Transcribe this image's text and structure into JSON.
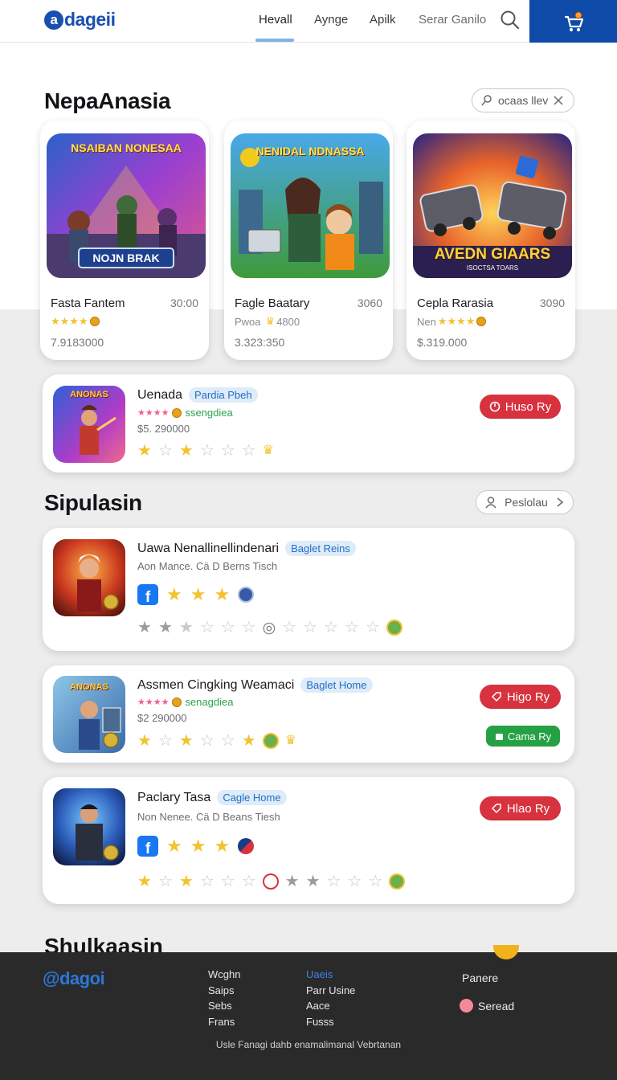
{
  "header": {
    "logo_text": "dageii",
    "logo_letter": "a",
    "nav": [
      "Hevall",
      "Aynge",
      "Apilk",
      "Serar Ganilo"
    ],
    "active_nav": "Hevall",
    "brand_color": "#0e4aa8"
  },
  "featured": {
    "title": "NepaAnasia",
    "filter_label": "ocaas llev",
    "cards": [
      {
        "art_title": "NSAIBAN NONESAA",
        "art_button": "NOJN BRAK",
        "title": "Fasta Fantem",
        "price": "30:00",
        "rating_text": "",
        "meta": "7.9183000"
      },
      {
        "art_title": "NENIDAL NDNASSA",
        "art_button": "",
        "title": "Fagle Baatary",
        "price": "3060",
        "rating_text": "Pwoa",
        "rating_extra": "4800",
        "meta": "3.323:350"
      },
      {
        "art_title": "AVEDN GIAARS",
        "art_button": "ISOCTSA TOARS",
        "title": "Cepla Rarasia",
        "price": "3090",
        "rating_text": "Nen",
        "meta": "$.319.000"
      }
    ]
  },
  "promo": {
    "thumb_text": "ANONAS",
    "title": "Uenada",
    "tag": "Pardia Pbeh",
    "rating_label": "ssengdiea",
    "price": "$5. 290000",
    "button": "Huso Ry"
  },
  "section2": {
    "title": "Sipulasin",
    "button": "Peslolau",
    "items": [
      {
        "title": "Uawa Nenallinellindenari",
        "tag": "Baglet Reins",
        "subtitle": "Aon Mance. Cä D Berns Tisch"
      },
      {
        "thumb_text": "ANONAS",
        "title": "Assmen Cingking Weamaci",
        "tag": "Baglet Home",
        "rating_label": "senagdiea",
        "price": "$2 290000",
        "button": "Higo Ry",
        "button2": "Cama Ry"
      },
      {
        "title": "Paclary Tasa",
        "tag": "Cagle Home",
        "subtitle": "Non Nenee. Cä D Beans Tiesh",
        "button": "Hlao Ry"
      }
    ]
  },
  "next_section_title": "Shulkaasin",
  "footer": {
    "logo": "@dagoi",
    "col1": [
      "Wcghn",
      "Saips",
      "Sebs",
      "Frans"
    ],
    "col2": [
      "Uaeis",
      "Parr Usine",
      "Aace",
      "Fusss"
    ],
    "col3": [
      "Panere",
      "Seread"
    ],
    "bottom": "Usle Fanagi dahb enamalimanal Vebrtanan"
  }
}
